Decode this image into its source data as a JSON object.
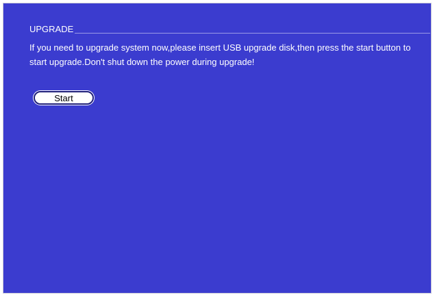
{
  "upgrade": {
    "title": "UPGRADE",
    "message": "If you need to upgrade system now,please insert USB upgrade disk,then press the start button to start upgrade.Don't shut down the power during upgrade!",
    "start_label": "Start"
  },
  "colors": {
    "background": "#3b3ccf",
    "text": "#ffffff",
    "button_bg": "#ffffff",
    "button_border": "#1e1e7a"
  }
}
